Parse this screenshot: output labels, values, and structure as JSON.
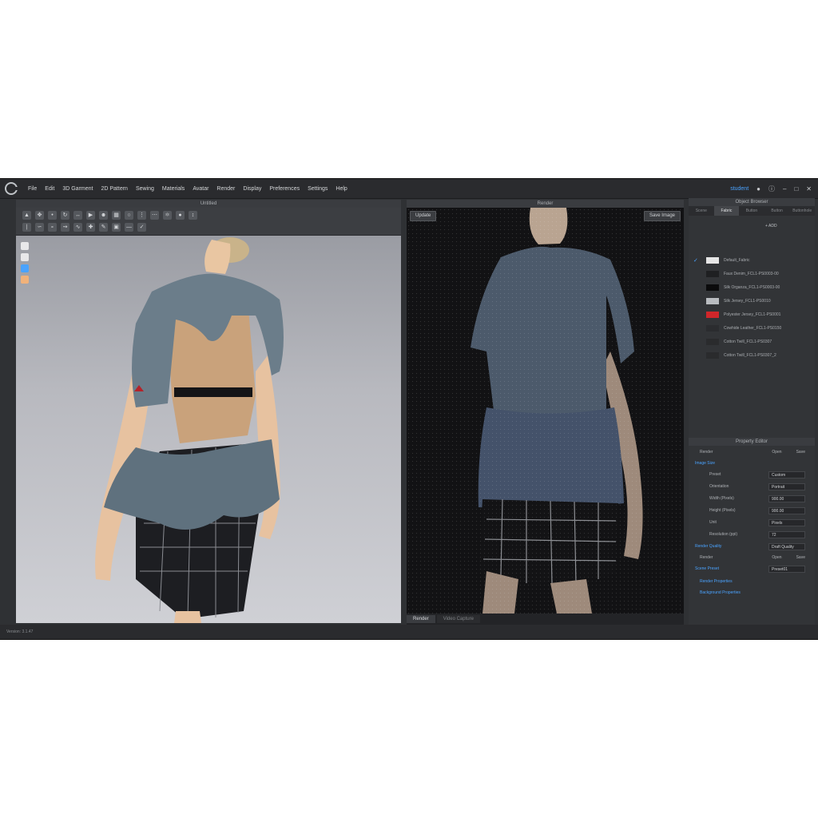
{
  "menu": [
    "File",
    "Edit",
    "3D Garment",
    "2D Pattern",
    "Sewing",
    "Materials",
    "Avatar",
    "Render",
    "Display",
    "Preferences",
    "Settings",
    "Help"
  ],
  "user": "student",
  "panels": {
    "view3d_title": "Untitled",
    "render_title": "Render",
    "object_browser_title": "Object Browser",
    "property_editor_title": "Property Editor"
  },
  "render": {
    "update_label": "Update",
    "save_image_label": "Save Image",
    "tabs": [
      "Render",
      "Video Capture"
    ]
  },
  "object_browser": {
    "tabs": [
      "Scene",
      "Fabric",
      "Button",
      "Button",
      "Buttonhole"
    ],
    "active_tab": 1,
    "add_label": "+ ADD",
    "fabrics": [
      {
        "name": "Default_Fabric",
        "color": "#e6e6e6",
        "checked": true
      },
      {
        "name": "Faux Denim_FCL1-PS0003-00",
        "color": "#1f2022",
        "checked": false
      },
      {
        "name": "Silk Organza_FCL1-PS0003-00",
        "color": "#0b0b0c",
        "checked": false
      },
      {
        "name": "Silk Jersey_FCL1-PS0010",
        "color": "#b9bcc0",
        "checked": false
      },
      {
        "name": "Polyester Jersey_FCL1-PS0001",
        "color": "#d0262a",
        "checked": false
      },
      {
        "name": "Cowhide Leather_FCL1-PS0150",
        "color": "#2b2c2f",
        "checked": false
      },
      {
        "name": "Cotton Twill_FCL1-PS0307",
        "color": "#2a2b2d",
        "checked": false
      },
      {
        "name": "Cotton Twill_FCL1-PS0307_2",
        "color": "#2a2b2d",
        "checked": false
      }
    ]
  },
  "property_editor": {
    "render_label": "Render",
    "open_label": "Open",
    "save_label": "Save",
    "image_size_label": "Image Size",
    "rows": [
      {
        "label": "Preset",
        "value": "Custom"
      },
      {
        "label": "Orientation",
        "value": "Portrait"
      },
      {
        "label": "Width (Pixels)",
        "value": "900.00"
      },
      {
        "label": "Height (Pixels)",
        "value": "900.00"
      },
      {
        "label": "Unit",
        "value": "Pixels"
      },
      {
        "label": "Resolution (ppi)",
        "value": "72"
      }
    ],
    "render_quality_label": "Render Quality",
    "render_quality_value": "Draft Quality",
    "scene_preset_label": "Scene Preset",
    "scene_preset_value": "Preset01",
    "render_properties_label": "Render Properties",
    "background_properties_label": "Background Properties"
  },
  "status": "Version: 3.1.47"
}
